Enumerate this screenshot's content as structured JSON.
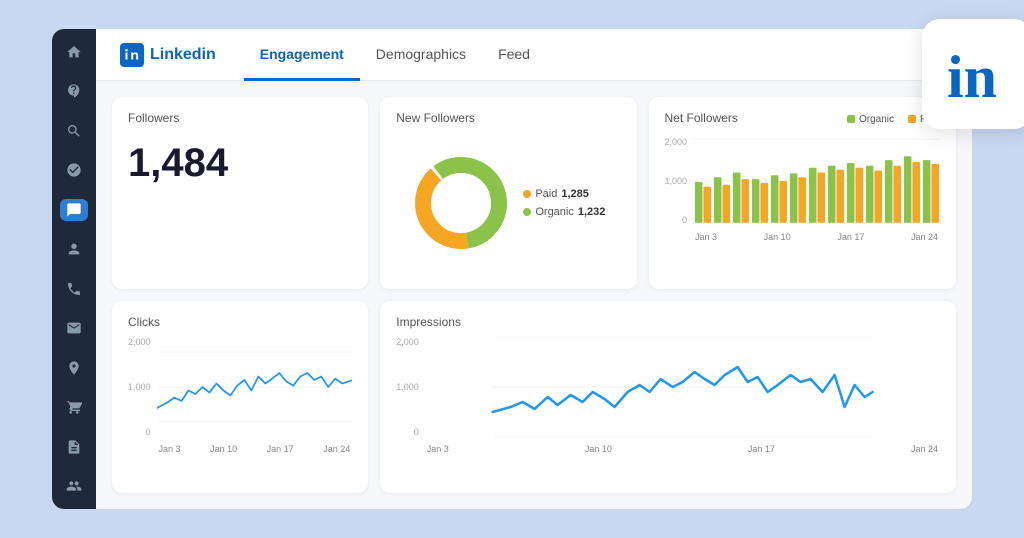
{
  "app": {
    "name": "Linkedin",
    "logo_text": "in"
  },
  "nav": {
    "tabs": [
      {
        "id": "engagement",
        "label": "Engagement",
        "active": true
      },
      {
        "id": "demographics",
        "label": "Demographics",
        "active": false
      },
      {
        "id": "feed",
        "label": "Feed",
        "active": false
      }
    ]
  },
  "sidebar": {
    "icons": [
      {
        "name": "home-icon",
        "symbol": "⌂"
      },
      {
        "name": "chart-icon",
        "symbol": "◑"
      },
      {
        "name": "search-icon",
        "symbol": "⌕"
      },
      {
        "name": "layers-icon",
        "symbol": "◉"
      },
      {
        "name": "message-icon",
        "symbol": "✉",
        "active": true
      },
      {
        "name": "users-icon",
        "symbol": "⊙"
      },
      {
        "name": "phone-icon",
        "symbol": "☎"
      },
      {
        "name": "email-icon",
        "symbol": "✉"
      },
      {
        "name": "location-icon",
        "symbol": "⊕"
      },
      {
        "name": "cart-icon",
        "symbol": "⊞"
      },
      {
        "name": "document-icon",
        "symbol": "⊟"
      },
      {
        "name": "group-icon",
        "symbol": "⊕"
      }
    ]
  },
  "cards": {
    "followers": {
      "title": "Followers",
      "value": "1,484"
    },
    "new_followers": {
      "title": "New Followers",
      "paid_label": "Paid",
      "paid_value": "1,285",
      "organic_label": "Organic",
      "organic_value": "1,232",
      "paid_color": "#f5a623",
      "organic_color": "#8bc34a"
    },
    "net_followers": {
      "title": "Net Followers",
      "organic_label": "Organic",
      "paid_label": "Paid",
      "organic_color": "#8bc34a",
      "paid_color": "#f5a623",
      "y_labels": [
        "2,000",
        "1,000",
        "0"
      ],
      "x_labels": [
        "Jan 3",
        "Jan 10",
        "Jan 17",
        "Jan 24"
      ]
    },
    "clicks": {
      "title": "Clicks",
      "y_labels": [
        "2,000",
        "1,000",
        "0"
      ],
      "x_labels": [
        "Jan 3",
        "Jan 10",
        "Jan 17",
        "Jan 24"
      ]
    },
    "impressions": {
      "title": "Impressions",
      "y_labels": [
        "2,000",
        "1,000",
        "0"
      ],
      "x_labels": [
        "Jan 3",
        "Jan 10",
        "Jan 17",
        "Jan 24"
      ]
    }
  },
  "colors": {
    "accent": "#0a66c2",
    "sidebar_bg": "#1e2a3a",
    "card_bg": "#ffffff",
    "line_blue": "#2196f3"
  }
}
